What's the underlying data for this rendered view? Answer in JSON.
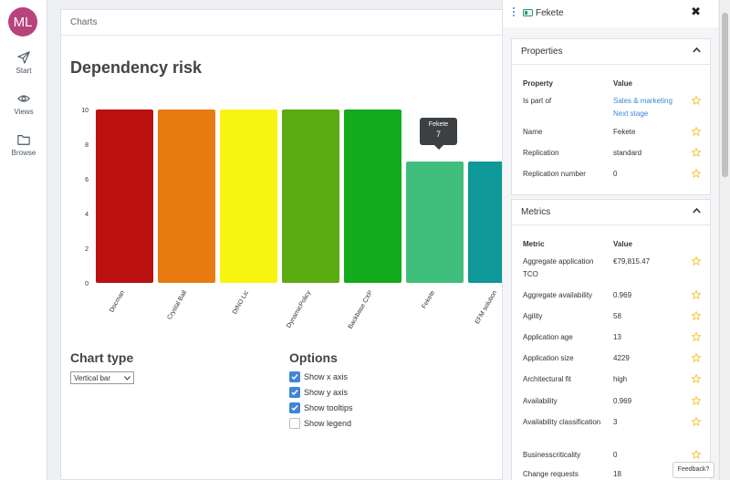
{
  "nav": {
    "avatar": "ML",
    "items": [
      {
        "label": "Start",
        "icon": "send-icon"
      },
      {
        "label": "Views",
        "icon": "eye-icon"
      },
      {
        "label": "Browse",
        "icon": "folder-icon"
      }
    ]
  },
  "main": {
    "card_title": "Charts",
    "page_title": "Dependency risk",
    "tooltip": {
      "label": "Fekete",
      "value": "7"
    },
    "chart_type_title": "Chart type",
    "chart_type_value": "Vertical bar",
    "options_title": "Options",
    "options": [
      {
        "label": "Show x axis",
        "checked": true
      },
      {
        "label": "Show y axis",
        "checked": true
      },
      {
        "label": "Show tooltips",
        "checked": true
      },
      {
        "label": "Show legend",
        "checked": false
      }
    ]
  },
  "chart_data": {
    "type": "bar",
    "categories": [
      "Docman",
      "Crystal Ball",
      "DINO Lic",
      "DynamicPolicy",
      "Backbase CXP",
      "Fekete",
      "EFM solution"
    ],
    "values": [
      10,
      10,
      10,
      10,
      10,
      7,
      7
    ],
    "colors": [
      "#bb1111",
      "#e77b12",
      "#f7f411",
      "#5aab11",
      "#13ab1b",
      "#3fbe7c",
      "#0e9898"
    ],
    "yticks": [
      "0",
      "2",
      "4",
      "6",
      "8",
      "10"
    ],
    "ylim": [
      0,
      10
    ],
    "grid": false
  },
  "panel": {
    "title": "Fekete",
    "properties": {
      "title": "Properties",
      "col_property": "Property",
      "col_value": "Value",
      "rows": [
        {
          "key": "Is part of",
          "value": "Sales & marketing",
          "value2": "Next stage"
        },
        {
          "key": "Name",
          "value": "Fekete"
        },
        {
          "key": "Replication",
          "value": "standard"
        },
        {
          "key": "Replication number",
          "value": "0"
        }
      ]
    },
    "metrics": {
      "title": "Metrics",
      "col_metric": "Metric",
      "col_value": "Value",
      "rows": [
        {
          "key": "Aggregate application TCO",
          "value": "€79,815.47"
        },
        {
          "key": "Aggregate availability",
          "value": "0.969"
        },
        {
          "key": "Agility",
          "value": "58"
        },
        {
          "key": "Application age",
          "value": "13"
        },
        {
          "key": "Application size",
          "value": "4229"
        },
        {
          "key": "Architectural fit",
          "value": "high"
        },
        {
          "key": "Availability",
          "value": "0.969"
        },
        {
          "key": "Availability classification",
          "value": "3"
        },
        {
          "key": "Businesscriticality",
          "value": "0"
        },
        {
          "key": "Change requests",
          "value": "18"
        }
      ]
    }
  },
  "feedback": "Feedback?",
  "colors": {
    "accent": "#3d86d8",
    "avatar": "#b8437c",
    "star": "#f2c12e"
  }
}
